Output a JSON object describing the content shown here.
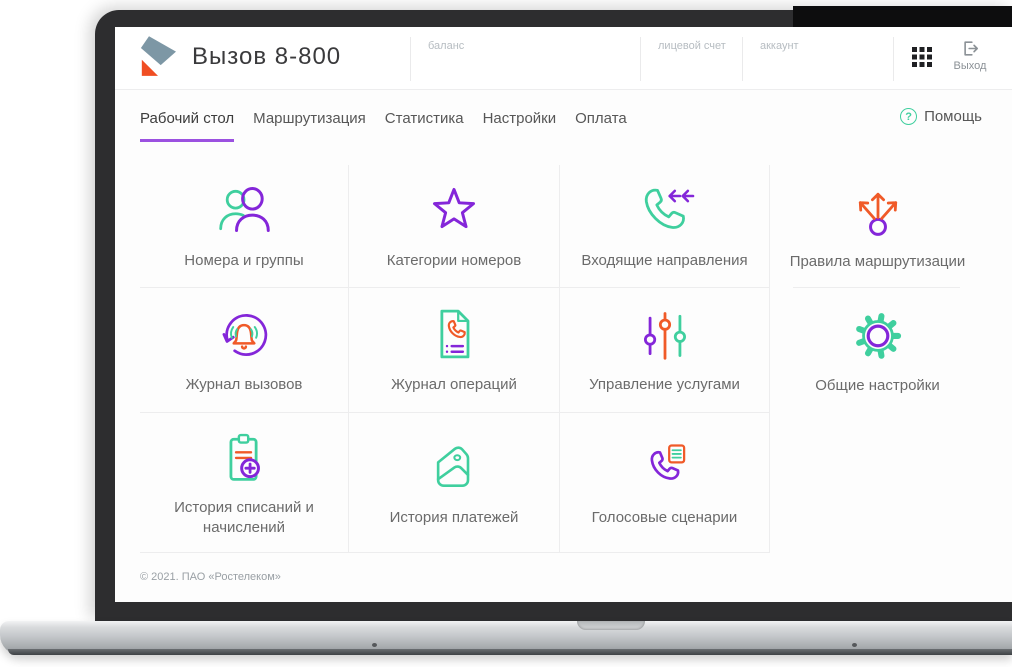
{
  "app": {
    "title": "Вызов 8-800"
  },
  "header": {
    "balance_label": "баланс",
    "personal_account_label": "лицевой счет",
    "account_label": "аккаунт",
    "logout_label": "Выход"
  },
  "nav": {
    "tabs": [
      {
        "label": "Рабочий стол",
        "active": true
      },
      {
        "label": "Маршрутизация",
        "active": false
      },
      {
        "label": "Статистика",
        "active": false
      },
      {
        "label": "Настройки",
        "active": false
      },
      {
        "label": "Оплата",
        "active": false
      }
    ],
    "help_label": "Помощь",
    "help_icon_glyph": "?"
  },
  "tiles": [
    {
      "label": "Номера и группы",
      "icon": "users-icon"
    },
    {
      "label": "Категории номеров",
      "icon": "star-icon"
    },
    {
      "label": "Входящие направления",
      "icon": "incoming-call-icon"
    },
    {
      "label": "Правила маршрутизации",
      "icon": "route-split-icon"
    },
    {
      "label": "Журнал вызовов",
      "icon": "call-log-bell-icon"
    },
    {
      "label": "Журнал операций",
      "icon": "operations-document-icon"
    },
    {
      "label": "Управление услугами",
      "icon": "sliders-icon"
    },
    {
      "label": "Общие настройки",
      "icon": "gear-icon"
    },
    {
      "label": "История списаний и начислений",
      "icon": "clipboard-plus-icon"
    },
    {
      "label": "История платежей",
      "icon": "wallet-icon"
    },
    {
      "label": "Голосовые сценарии",
      "icon": "voice-script-phone-icon"
    }
  ],
  "footer": {
    "copyright": "© 2021. ПАО «Ростелеком»"
  },
  "colors": {
    "accent_purple": "#8426d9",
    "accent_green": "#3fcf9e",
    "accent_orange": "#f05a28",
    "active_tab_underline": "#9b51e0",
    "logo_slate": "#7d97a5",
    "logo_orange": "#f04e23"
  }
}
